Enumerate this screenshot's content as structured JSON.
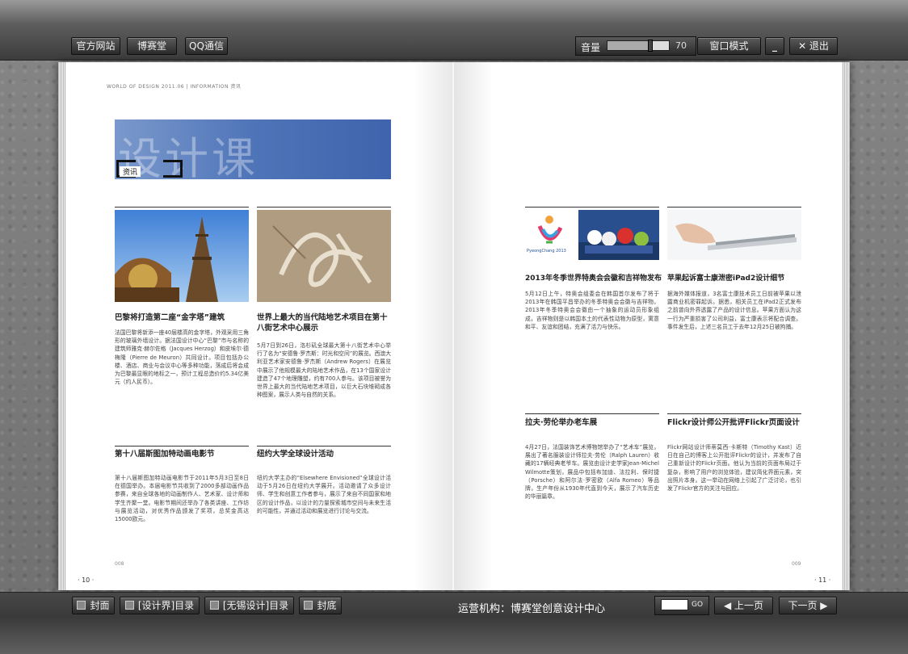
{
  "toolbar": {
    "official_site": "官方网站",
    "bosaitang": "博赛堂",
    "qq": "QQ通信",
    "volume_label": "音量",
    "volume_value": "70",
    "volume_level": 0.7,
    "window_mode": "窗口模式",
    "minimize": "_",
    "exit": "✕ 退出"
  },
  "bottom": {
    "cover": "封面",
    "toc1": "[设计界]目录",
    "toc2": "[无锡设计]目录",
    "back_cover": "封底",
    "operator": "运营机构：博赛堂创意设计中心",
    "go": "GO",
    "prev": "◀ 上一页",
    "next": "下一页 ▶"
  },
  "left_page": {
    "header": "WORLD OF DESIGN 2011.06  |  INFORMATION 资讯",
    "banner_big": "设计课",
    "banner_tag": "资讯",
    "articles": [
      {
        "title": "巴黎将打造第二座“金字塔”建筑",
        "body": "法国巴黎将新添一座40层楼高的金字塔，外观采用三角形的玻璃外墙设计。据法国设计中心“巴黎”市与名称的建筑师雅克·赫尔佐格（Jacques Herzog）和皮埃尔·德梅隆（Pierre de Meuron）共同设计。项目包括办公楼、酒店、商业与会议中心等多种功能，落成后将会成为巴黎最显眼的地标之一，预计工程总造价约5.34亿美元（约人民币）。"
      },
      {
        "title": "世界上最大的当代陆地艺术项目在第十八街艺术中心展示",
        "body": "5月7日到26日，洛杉矶全球最大第十八街艺术中心举行了名为“安德鲁·罗杰斯：时光和空间”的展览。西澳大利亚艺术家安德鲁·罗杰斯（Andrew Rogers）在展览中展示了他规模最大的陆地艺术作品，在13个国家设计建造了47个地理雕塑，约有700人参与。该项目被誉为世界上最大的当代陆地艺术项目，以巨大石块堆砌成各种图案，展示人类与自然的关系。"
      },
      {
        "title": "第十八届斯图加特动画电影节",
        "body": "第十八届斯图加特动画电影节于2011年5月3日至8日在德国举办。本届电影节共收到了2000多部动画作品参赛，来自全球各地的动画制作人、艺术家、设计师和学生齐聚一堂。电影节期间还举办了各类讲座、工作坊与展览活动，对优秀作品颁发了奖项，总奖金高达15000欧元。"
      },
      {
        "title": "纽约大学全球设计活动",
        "body": "纽约大学主办的“Elsewhere Envisioned”全球设计活动于5月26日在纽约大学展开。活动邀请了众多设计师、学生和创意工作者参与，展示了来自不同国家和地区的设计作品，以设计的力量探索城市空间与未来生活的可能性，并通过活动和展览进行讨论与交流。"
      }
    ],
    "page_number": "· 10 ·",
    "folio": "008"
  },
  "right_page": {
    "articles": [
      {
        "title": "2013年冬季世界特奥会会徽和吉祥物发布",
        "logo_text": "PyeongChang 2013",
        "body": "5月12日上午，特奥会组委会在韩国首尔发布了将于2013年在韩国平昌举办的冬季特奥会会徽与吉祥物。2013年冬季特奥会会徽由一个抽象的运动员形象组成，吉祥物则是以韩国本土的代表性动物为原型，寓意和平、友谊和团结，充满了活力与快乐。"
      },
      {
        "title": "苹果起诉富士康泄密iPad2设计细节",
        "body": "据海外媒体报道，3名富士康技术员工日前被苹果以泄露商业机密罪起诉。据悉，相关员工在iPad2正式发布之前曾向外界透露了产品的设计信息。苹果方面认为这一行为严重损害了公司利益，富士康表示将配合调查。事件发生后，上述三名员工于去年12月25日被拘捕。"
      },
      {
        "title": "拉夫·劳伦举办老车展",
        "body": "4月27日，法国装饰艺术博物馆举办了“艺术车”展览，展出了著名服装设计师拉夫·劳伦（Ralph Lauren）收藏的17辆经典老爷车。展览由设计史学家Jean-Michel Wilmotte策划，展品中包括布加迪、法拉利、保时捷（Porsche）和阿尔法·罗密欧（Alfa Romeo）等品牌，生产年份从1930年代直到今天，展示了汽车历史的华丽篇章。"
      },
      {
        "title": "Flickr设计师公开批评Flickr页面设计",
        "body": "Flickr网站设计师蒂莫西·卡斯特（Timothy Kast）近日在自己的博客上公开批评Flickr的设计，并发布了自己重新设计的Flickr页面。他认为当前的页面布局过于复杂，影响了用户的浏览体验，建议简化界面元素，突出照片本身。这一举动在网络上引起了广泛讨论，也引发了Flickr官方的关注与回应。"
      }
    ],
    "page_number": "· 11 ·",
    "folio": "009"
  }
}
